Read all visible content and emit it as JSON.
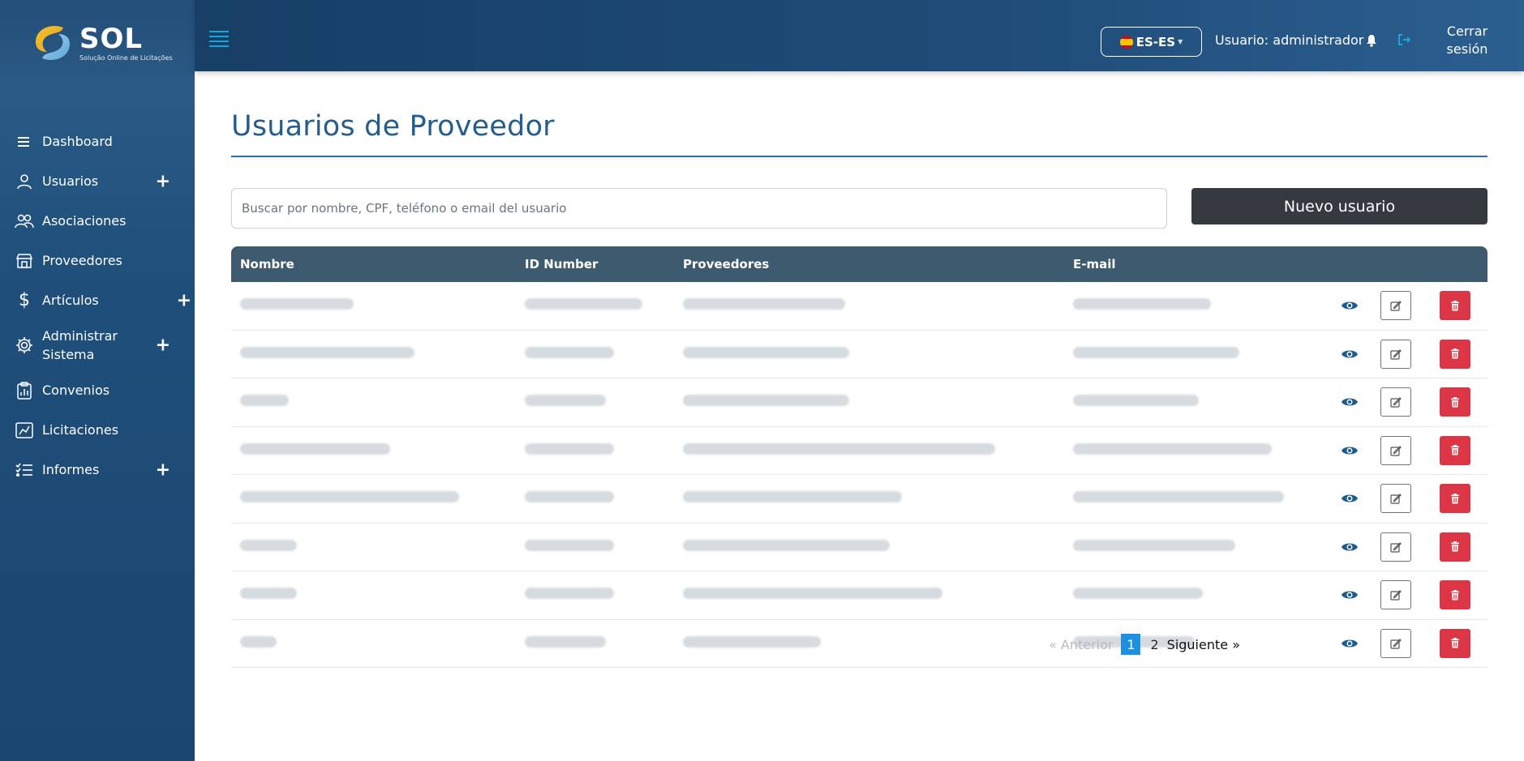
{
  "brand": {
    "name": "SOL",
    "tagline": "Solução Online de Licitações"
  },
  "sidebar": {
    "items": [
      {
        "label": "Dashboard",
        "icon": "list-icon",
        "has_plus": false
      },
      {
        "label": "Usuarios",
        "icon": "user-icon",
        "has_plus": true
      },
      {
        "label": "Asociaciones",
        "icon": "users-icon",
        "has_plus": false
      },
      {
        "label": "Proveedores",
        "icon": "store-icon",
        "has_plus": false
      },
      {
        "label": "Artículos",
        "icon": "dollar-icon",
        "has_plus": true
      },
      {
        "label": "Administrar Sistema",
        "icon": "gear-icon",
        "has_plus": true
      },
      {
        "label": "Convenios",
        "icon": "clipboard-chart-icon",
        "has_plus": false
      },
      {
        "label": "Licitaciones",
        "icon": "chart-board-icon",
        "has_plus": false
      },
      {
        "label": "Informes",
        "icon": "checklist-icon",
        "has_plus": true
      }
    ]
  },
  "header": {
    "language": "ES-ES",
    "user_label": "Usuario: administrador",
    "logout_line1": "Cerrar",
    "logout_line2": "sesión"
  },
  "main": {
    "title": "Usuarios de Proveedor",
    "search_placeholder": "Buscar por nombre, CPF, teléfono o email del usuario",
    "new_user_label": "Nuevo usuario",
    "columns": [
      "Nombre",
      "ID Number",
      "Proveedores",
      "E-mail"
    ],
    "rows_count_visible": 8,
    "pagination": {
      "prev": "« Anterior",
      "pages": [
        "1",
        "2"
      ],
      "active_page": "1",
      "next": "Siguiente »"
    }
  },
  "colors": {
    "sidebar": "#1f4f7b",
    "title": "#255e8e",
    "table_header": "#3e5a6f",
    "primary_dark": "#343a40",
    "danger": "#dc3545",
    "accent": "#1aa5d8",
    "active_page": "#1e90e0"
  }
}
